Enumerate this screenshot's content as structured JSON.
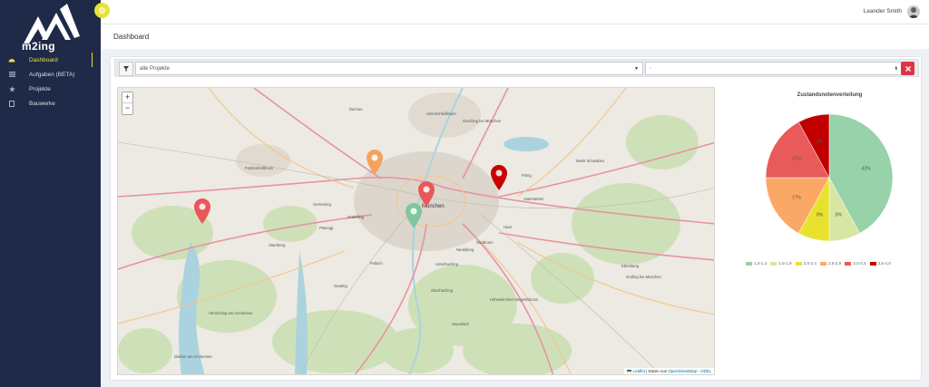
{
  "app": {
    "logo_text": "m2ing"
  },
  "sidebar": {
    "items": [
      {
        "label": "Dashboard",
        "icon": "dashboard-gauge-icon",
        "active": true
      },
      {
        "label": "Aufgaben (BETA)",
        "icon": "tasks-list-icon",
        "active": false
      },
      {
        "label": "Projekte",
        "icon": "star-icon",
        "active": false
      },
      {
        "label": "Bauwerke",
        "icon": "document-icon",
        "active": false
      }
    ]
  },
  "header": {
    "user_name": "Leander Smith"
  },
  "page": {
    "title": "Dashboard"
  },
  "filters": {
    "project_select": "alle Projekte",
    "second_select": "-"
  },
  "map": {
    "zoom_in": "+",
    "zoom_out": "−",
    "attribution_leaflet": "Leaflet",
    "attribution_text": "| Daten von",
    "attribution_osm": "OpenStreetMap",
    "attribution_sep": "-",
    "attribution_license": "ODbL",
    "city_label": "München",
    "place_labels": [
      "Dachau",
      "Unterschleißheim",
      "Garching bei München",
      "Fürstenfeldbruck",
      "Germering",
      "Gräfelfing",
      "Planegg",
      "Starnberg",
      "Ottobrunn",
      "Neubiberg",
      "Unterhaching",
      "Haar",
      "Oberhaching",
      "Sauerlach",
      "Ebersberg",
      "Grafing bei München",
      "Markt Schwaben",
      "Poing",
      "Vaterstetten",
      "Gauting",
      "Herrsching am Ammersee",
      "Dießen am Ammersee",
      "Pullach",
      "Höhenkirchen-Siegertsbrunn"
    ],
    "markers": [
      {
        "color": "#f5a25d",
        "label": "marker-orange"
      },
      {
        "color": "#e8575a",
        "label": "marker-red"
      },
      {
        "color": "#7fc79e",
        "label": "marker-green"
      },
      {
        "color": "#c90000",
        "label": "marker-darkred"
      },
      {
        "color": "#e8575a",
        "label": "marker-red-west"
      }
    ]
  },
  "chart_data": {
    "type": "pie",
    "title": "Zustandsnotenverteilung",
    "categories": [
      "1,0-1,4",
      "1,5-1,9",
      "2,0-2,4",
      "2,5-2,9",
      "3,0-3,4",
      "3,5-4,0"
    ],
    "values": [
      42,
      8,
      8,
      17,
      17,
      8
    ],
    "labels": [
      "42%",
      "8%",
      "8%",
      "17%",
      "17%",
      "8%"
    ],
    "colors": [
      "#97d2aa",
      "#d8e6a3",
      "#e8e22e",
      "#fba867",
      "#e95a5a",
      "#c00000"
    ],
    "legend_position": "bottom"
  }
}
